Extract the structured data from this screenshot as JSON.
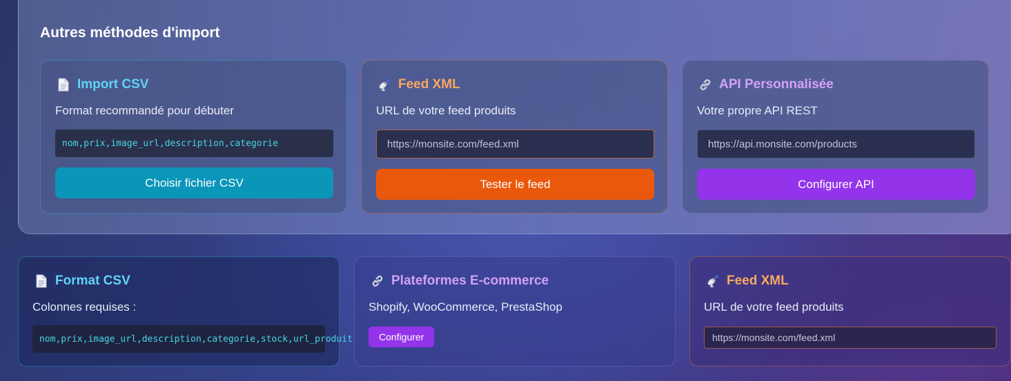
{
  "panel": {
    "title": "Autres méthodes d'import",
    "cards": [
      {
        "icon": "document-icon",
        "title": "Import CSV",
        "description": "Format recommandé pour débuter",
        "code": "nom,prix,image_url,description,categorie",
        "button": "Choisir fichier CSV"
      },
      {
        "icon": "satellite-icon",
        "title": "Feed XML",
        "description": "URL de votre feed produits",
        "placeholder": "https://monsite.com/feed.xml",
        "button": "Tester le feed"
      },
      {
        "icon": "link-icon",
        "title": "API Personnalisée",
        "description": "Votre propre API REST",
        "placeholder": "https://api.monsite.com/products",
        "button": "Configurer API"
      }
    ]
  },
  "bottom": [
    {
      "icon": "document-icon",
      "title": "Format CSV",
      "description": "Colonnes requises :",
      "code": "nom,prix,image_url,description,categorie,stock,url_produit"
    },
    {
      "icon": "link-icon",
      "title": "Plateformes E-commerce",
      "description": "Shopify, WooCommerce, PrestaShop",
      "button": "Configurer"
    },
    {
      "icon": "satellite-icon",
      "title": "Feed XML",
      "description": "URL de votre feed produits",
      "placeholder": "https://monsite.com/feed.xml"
    }
  ],
  "colors": {
    "cyan": "#5fd3f5",
    "orange": "#f7a860",
    "purple": "#d3a2f5",
    "csv_button": "#0a95b9",
    "feed_button": "#ea580c",
    "api_button": "#9333ea"
  }
}
